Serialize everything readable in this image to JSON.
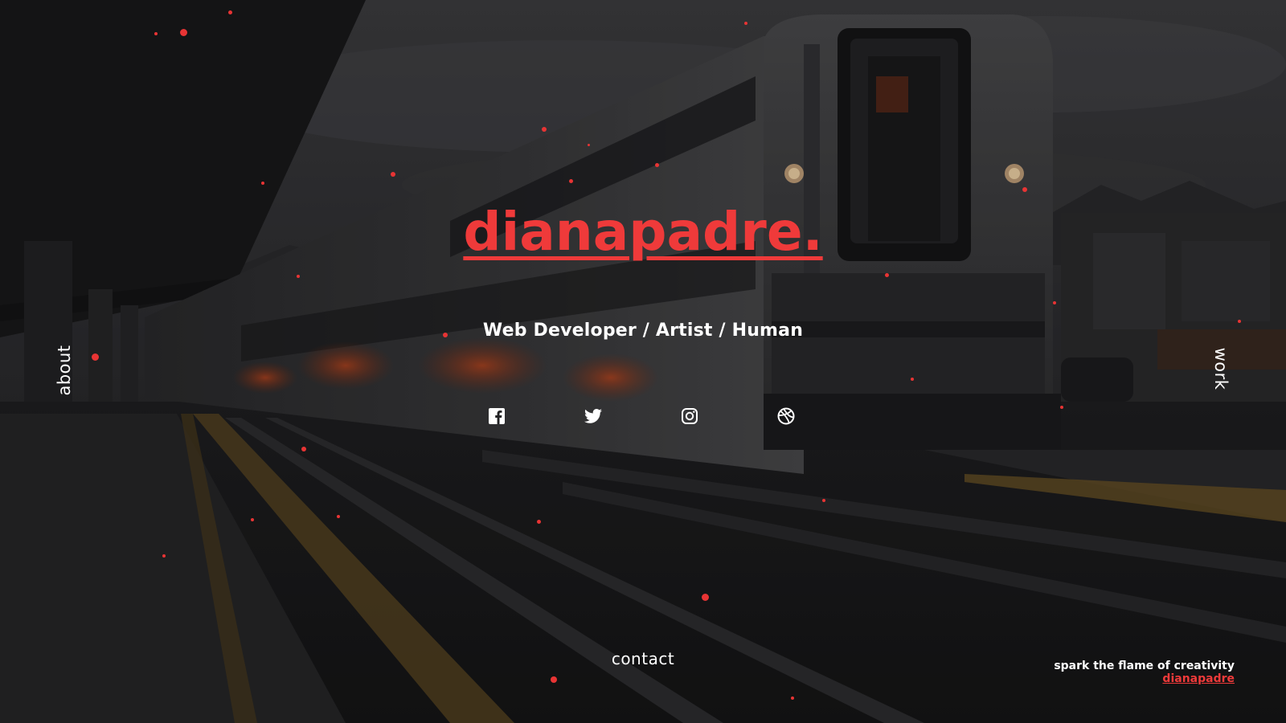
{
  "brand": {
    "name": "dianapadre."
  },
  "hero": {
    "tagline": "Web Developer / Artist / Human"
  },
  "socials": [
    {
      "icon": "facebook-icon"
    },
    {
      "icon": "twitter-icon"
    },
    {
      "icon": "instagram-icon"
    },
    {
      "icon": "dribbble-icon"
    }
  ],
  "nav": {
    "about_label": "about",
    "work_label": "work",
    "contact_label": "contact"
  },
  "footer": {
    "motto": "spark the flame of creativity",
    "signature": "dianapadre"
  },
  "colors": {
    "accent": "#ef3a3a",
    "text": "#ffffff",
    "background": "#1b1b1c"
  }
}
